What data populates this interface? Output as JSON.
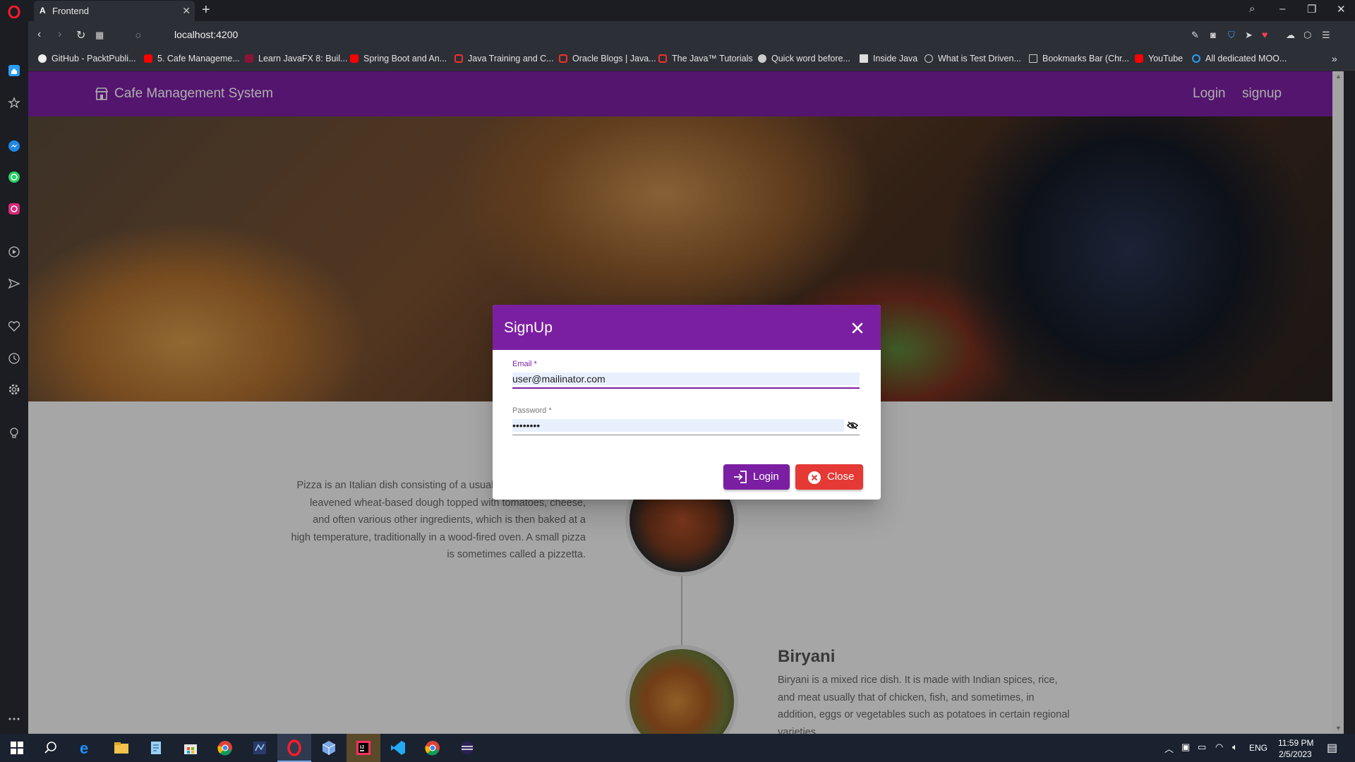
{
  "browser": {
    "tab_title": "Frontend",
    "tab_favicon": "A",
    "url": "localhost:4200",
    "bookmarks": [
      "GitHub - PacktPubli...",
      "5. Cafe Manageme...",
      "Learn JavaFX 8: Buil...",
      "Spring Boot and An...",
      "Java Training and C...",
      "Oracle Blogs | Java...",
      "The Java™ Tutorials",
      "Quick word before...",
      "Inside Java",
      "What is Test Driven...",
      "Bookmarks Bar (Chr...",
      "YouTube",
      "All dedicated MOO..."
    ],
    "bookmark_icons": [
      "github-icon",
      "youtube-icon",
      "jetbrains-icon",
      "youtube-icon",
      "oracle-icon",
      "oracle-icon",
      "oracle-icon",
      "site-icon",
      "document-icon",
      "site-icon",
      "folder-icon",
      "youtube-icon",
      "link-icon"
    ]
  },
  "app": {
    "title": "Cafe Management System",
    "nav_login": "Login",
    "nav_signup": "signup"
  },
  "content": {
    "pizza_text": "Pizza is an Italian dish consisting of a usually round, flat base of leavened wheat-based dough topped with tomatoes, cheese, and often various other ingredients, which is then baked at a high temperature, traditionally in a wood-fired oven. A small pizza is sometimes called a pizzetta.",
    "biryani_title": "Biryani",
    "biryani_text": "Biryani is a mixed rice dish. It is made with Indian spices, rice, and meat usually that of chicken, fish, and sometimes, in addition, eggs or vegetables such as potatoes in certain regional varieties."
  },
  "dialog": {
    "title": "SignUp",
    "email_label": "Email *",
    "email_value": "user@mailinator.com",
    "password_label": "Password *",
    "password_value": "********",
    "login_label": "Login",
    "close_label": "Close"
  },
  "taskbar": {
    "lang": "ENG",
    "time": "11:59 PM",
    "date": "2/5/2023"
  },
  "colors": {
    "primary": "#7b1fa2",
    "warn": "#e53935"
  }
}
